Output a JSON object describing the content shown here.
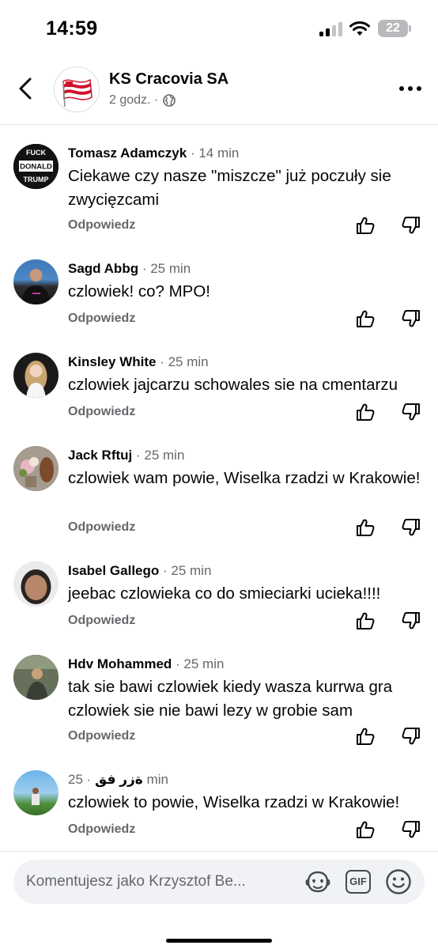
{
  "status_bar": {
    "time": "14:59",
    "battery": "22"
  },
  "header": {
    "page_name": "KS Cracovia SA",
    "meta": "2 godz. ·"
  },
  "comments": [
    {
      "name": "Tomasz Adamczyk",
      "time": "· 14 min",
      "text": "Ciekawe czy nasze \"miszcze\" już poczuły sie zwycięzcami",
      "reply": "Odpowiedz",
      "avatar_lines": [
        "FUCK",
        "DONALD",
        "TRUMP"
      ]
    },
    {
      "name": "Sagd Abbg",
      "time": "· 25 min",
      "text": "czlowiek! co? MPO!",
      "reply": "Odpowiedz"
    },
    {
      "name": "Kinsley White",
      "time": "· 25 min",
      "text": "czlowiek jajcarzu schowales sie na cmentarzu",
      "reply": "Odpowiedz"
    },
    {
      "name": "Jack Rftuj",
      "time": "· 25 min",
      "text": "czlowiek wam powie, Wiselka rzadzi w Krakowie!",
      "reply": "Odpowiedz"
    },
    {
      "name": "Isabel Gallego",
      "time": "· 25 min",
      "text": "jeebac czlowieka co do smieciarki ucieka!!!!",
      "reply": "Odpowiedz"
    },
    {
      "name": "Hdv Mohammed",
      "time": "· 25 min",
      "text": "tak sie bawi czlowiek kiedy wasza kurrwa gra czlowiek sie nie bawi lezy w grobie sam",
      "reply": "Odpowiedz"
    },
    {
      "name": "ةزر فق",
      "time": "· 25 min",
      "text": "czlowiek to powie, Wiselka rzadzi w Krakowie!",
      "reply": "Odpowiedz"
    }
  ],
  "composer": {
    "placeholder": "Komentujesz jako Krzysztof Be...",
    "gif_label": "GIF"
  },
  "colors": {
    "secondary_text": "#65676b",
    "primary_text": "#050505",
    "divider": "#e4e6eb",
    "composer_bg": "#f0f2f5"
  }
}
